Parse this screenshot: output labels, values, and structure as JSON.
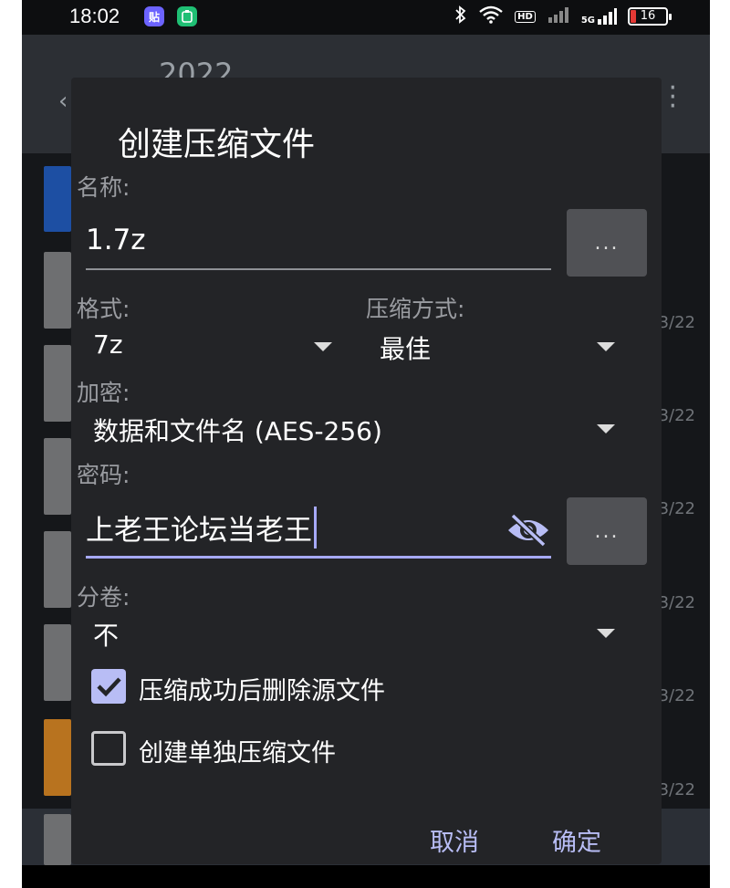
{
  "status_bar": {
    "time": "18:02",
    "app_badge_1": "贴",
    "network_badge": "HD",
    "network_type": "5G",
    "battery_level": "16",
    "battery_color": "#e53935"
  },
  "background": {
    "title": "2022",
    "dates": [
      "3/22",
      "3/22",
      "3/22",
      "3/22",
      "3/22",
      "3/22"
    ]
  },
  "dialog": {
    "title": "创建压缩文件",
    "name_label": "名称:",
    "name_value": "1.7z",
    "more_label": "...",
    "format_label": "格式:",
    "format_value": "7z",
    "compression_label": "压缩方式:",
    "compression_value": "最佳",
    "encryption_label": "加密:",
    "encryption_value": "数据和文件名 (AES-256)",
    "password_label": "密码:",
    "password_value": "上老王论坛当老王",
    "split_label": "分卷:",
    "split_value": "不",
    "delete_source_label": "压缩成功后删除源文件",
    "delete_source_checked": true,
    "separate_archive_label": "创建单独压缩文件",
    "separate_archive_checked": false,
    "cancel_label": "取消",
    "ok_label": "确定"
  },
  "colors": {
    "accent": "#b8bdf5",
    "dialog_bg": "#232427",
    "screen_bg": "#15171a"
  }
}
